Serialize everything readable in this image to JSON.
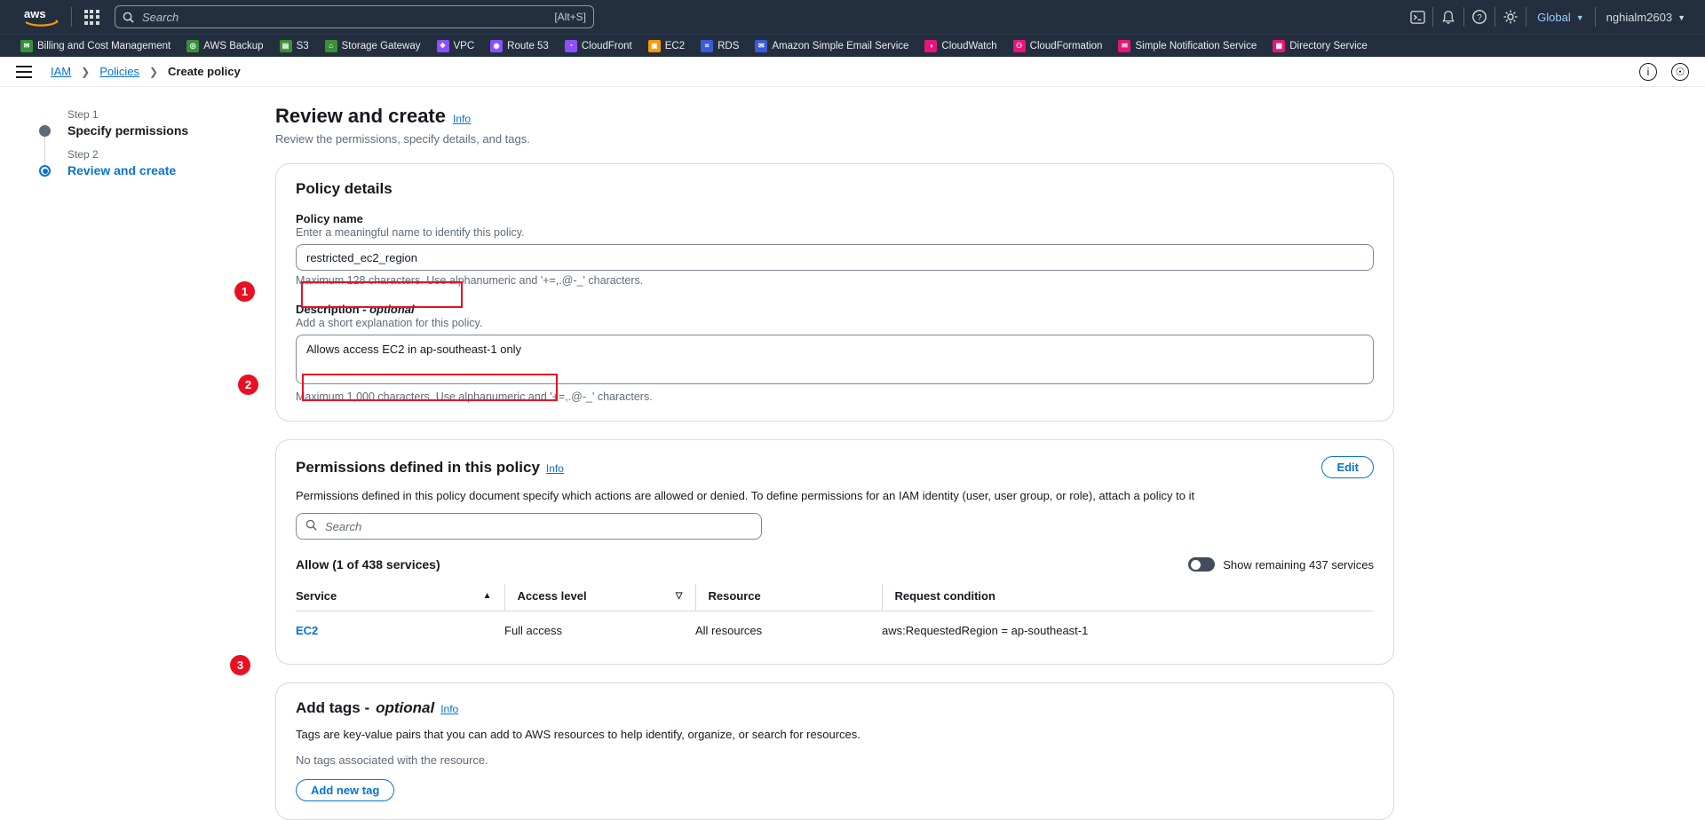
{
  "topnav": {
    "logo_alt": "aws",
    "search_placeholder": "Search",
    "search_value": "",
    "search_shortcut": "[Alt+S]",
    "region_label": "Global",
    "account_label": "nghialm2603"
  },
  "favorites": [
    {
      "label": "Billing and Cost Management",
      "color": "#3b8f3b",
      "glyph": "✉"
    },
    {
      "label": "AWS Backup",
      "color": "#3b8f3b",
      "glyph": "◎"
    },
    {
      "label": "S3",
      "color": "#3b8f3b",
      "glyph": "▤"
    },
    {
      "label": "Storage Gateway",
      "color": "#3b8f3b",
      "glyph": "⌂"
    },
    {
      "label": "VPC",
      "color": "#8c4fff",
      "glyph": "❖"
    },
    {
      "label": "Route 53",
      "color": "#8c4fff",
      "glyph": "◉"
    },
    {
      "label": "CloudFront",
      "color": "#8c4fff",
      "glyph": "◔"
    },
    {
      "label": "EC2",
      "color": "#ff9900",
      "glyph": "▣"
    },
    {
      "label": "RDS",
      "color": "#3b5bdb",
      "glyph": "⌗"
    },
    {
      "label": "Amazon Simple Email Service",
      "color": "#3b5bdb",
      "glyph": "✉"
    },
    {
      "label": "CloudWatch",
      "color": "#e7157b",
      "glyph": "◑"
    },
    {
      "label": "CloudFormation",
      "color": "#e7157b",
      "glyph": "⚇"
    },
    {
      "label": "Simple Notification Service",
      "color": "#e7157b",
      "glyph": "✉"
    },
    {
      "label": "Directory Service",
      "color": "#e7157b",
      "glyph": "▦"
    }
  ],
  "breadcrumb": {
    "items": [
      "IAM",
      "Policies",
      "Create policy"
    ]
  },
  "steps": [
    {
      "label": "Step 1",
      "title": "Specify permissions",
      "active": false
    },
    {
      "label": "Step 2",
      "title": "Review and create",
      "active": true
    }
  ],
  "page": {
    "title": "Review and create",
    "info_label": "Info",
    "subtitle": "Review the permissions, specify details, and tags."
  },
  "policy_details": {
    "card_title": "Policy details",
    "name_label": "Policy name",
    "name_hint": "Enter a meaningful name to identify this policy.",
    "name_value": "restricted_ec2_region",
    "name_foot": "Maximum 128 characters. Use alphanumeric and '+=,.@-_' characters.",
    "desc_label": "Description - ",
    "desc_label_optional": "optional",
    "desc_hint": "Add a short explanation for this policy.",
    "desc_value": "Allows access EC2 in ap-southeast-1 only",
    "desc_foot": "Maximum 1,000 characters. Use alphanumeric and '+=,.@-_' characters."
  },
  "permissions": {
    "card_title": "Permissions defined in this policy",
    "info_label": "Info",
    "edit_label": "Edit",
    "description": "Permissions defined in this policy document specify which actions are allowed or denied. To define permissions for an IAM identity (user, user group, or role), attach a policy to it",
    "search_placeholder": "Search",
    "search_value": "",
    "allow_heading": "Allow (1 of 438 services)",
    "toggle_label": "Show remaining 437 services",
    "columns": [
      "Service",
      "Access level",
      "Resource",
      "Request condition"
    ],
    "rows": [
      {
        "service": "EC2",
        "access_level": "Full access",
        "resource": "All resources",
        "request_condition": "aws:RequestedRegion = ap-southeast-1"
      }
    ]
  },
  "tags": {
    "card_title": "Add tags - ",
    "card_title_optional": "optional",
    "info_label": "Info",
    "description": "Tags are key-value pairs that you can add to AWS resources to help identify, organize, or search for resources.",
    "empty_text": "No tags associated with the resource.",
    "add_button": "Add new tag"
  },
  "annotations": [
    {
      "number": "1"
    },
    {
      "number": "2"
    },
    {
      "number": "3"
    }
  ],
  "colors": {
    "accent": "#0972d3",
    "annotation": "#e81123",
    "navy": "#232f3e"
  }
}
